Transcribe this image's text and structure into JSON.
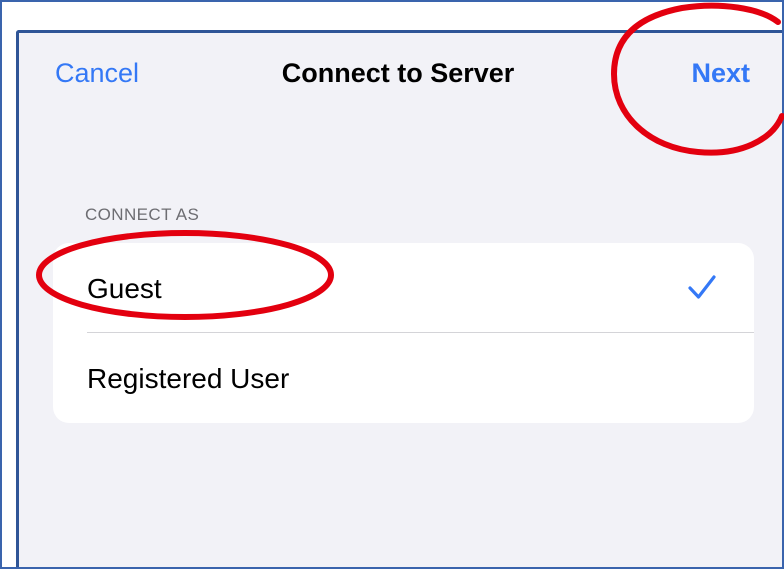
{
  "nav": {
    "cancel_label": "Cancel",
    "title": "Connect to Server",
    "next_label": "Next"
  },
  "connect_as": {
    "header": "CONNECT AS",
    "options": [
      {
        "label": "Guest",
        "selected": true
      },
      {
        "label": "Registered User",
        "selected": false
      }
    ]
  },
  "colors": {
    "accent": "#3478f6",
    "annotation": "#e3000f",
    "frame_border": "#2f5597",
    "background": "#f2f2f7"
  },
  "icons": {
    "selected_marker": "checkmark-icon"
  }
}
